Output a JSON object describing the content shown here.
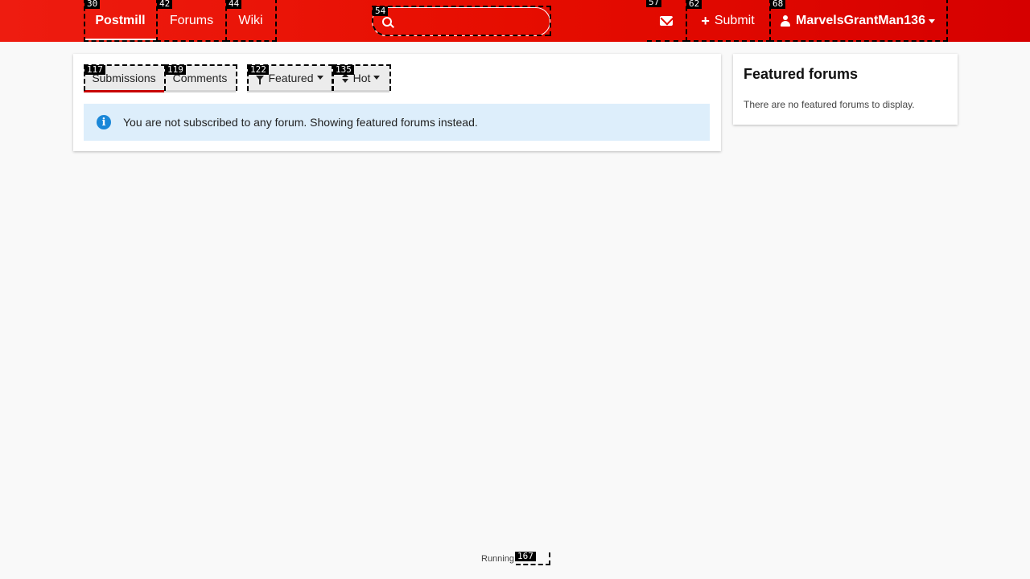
{
  "nav": {
    "brand": "Postmill",
    "forums": "Forums",
    "wiki": "Wiki",
    "search_placeholder": "",
    "submit": "Submit",
    "username": "MarvelsGrantMan136"
  },
  "markers": {
    "brand": "30",
    "forums": "42",
    "wiki": "44",
    "search": "54",
    "messages": "57",
    "submit": "62",
    "user": "68",
    "submissions": "117",
    "comments": "119",
    "featured": "122",
    "hot": "135",
    "footer": "167"
  },
  "main": {
    "tabs": {
      "submissions": "Submissions",
      "comments": "Comments",
      "featured": "Featured",
      "hot": "Hot"
    },
    "alert": "You are not subscribed to any forum. Showing featured forums instead."
  },
  "sidebar": {
    "title": "Featured forums",
    "empty": "There are no featured forums to display."
  },
  "footer": {
    "prefix": "Running",
    "link": "mill"
  },
  "colors": {
    "header": "#e60d00",
    "accent": "#c80000",
    "alert_bg": "#ddeefb",
    "info_icon": "#1a87d8"
  },
  "icons": [
    "search-icon",
    "envelope-icon",
    "plus-icon",
    "user-icon",
    "filter-icon",
    "sort-icon",
    "info-icon",
    "caret-down-icon"
  ]
}
